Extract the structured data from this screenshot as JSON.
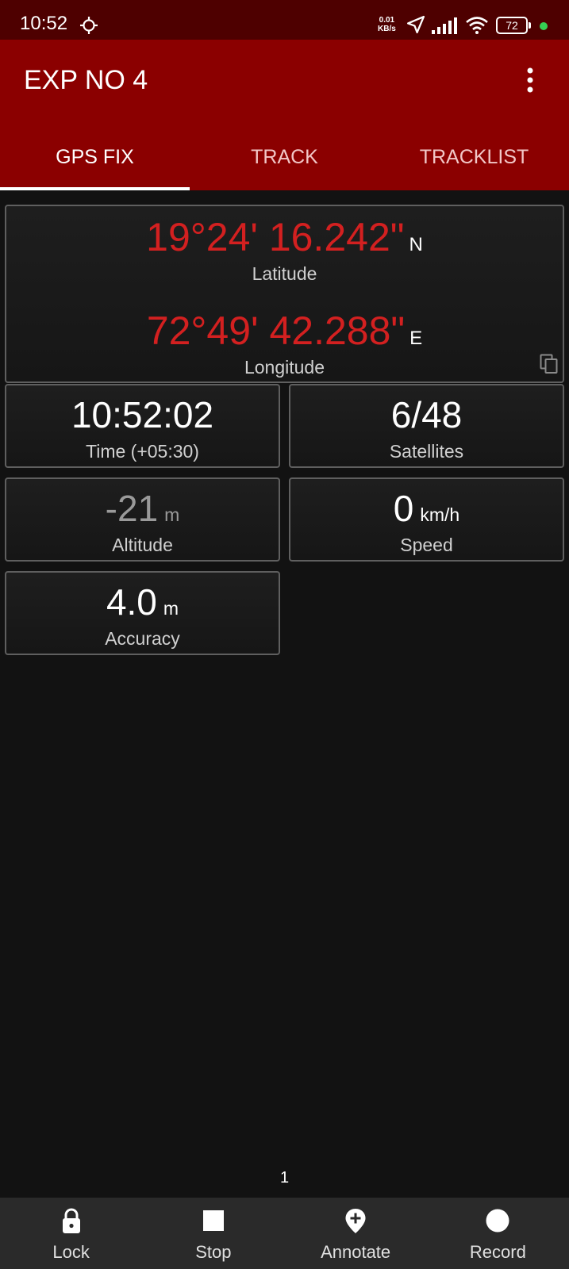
{
  "status_bar": {
    "time": "10:52",
    "net_speed_value": "0.01",
    "net_speed_unit": "KB/s",
    "battery": "72"
  },
  "app_bar": {
    "title": "EXP NO 4",
    "tabs": [
      {
        "label": "GPS FIX",
        "active": true
      },
      {
        "label": "TRACK",
        "active": false
      },
      {
        "label": "TRACKLIST",
        "active": false
      }
    ]
  },
  "coordinates": {
    "latitude_value": "19°24' 16.242\"",
    "latitude_hemisphere": "N",
    "latitude_label": "Latitude",
    "longitude_value": "72°49' 42.288\"",
    "longitude_hemisphere": "E",
    "longitude_label": "Longitude"
  },
  "stats": {
    "time": {
      "value": "10:52:02",
      "label": "Time (+05:30)"
    },
    "satellites": {
      "value": "6/48",
      "label": "Satellites"
    },
    "altitude": {
      "value": "-21",
      "unit": "m",
      "label": "Altitude"
    },
    "speed": {
      "value": "0",
      "unit": "km/h",
      "label": "Speed"
    },
    "accuracy": {
      "value": "4.0",
      "unit": "m",
      "label": "Accuracy"
    }
  },
  "page_number": "1",
  "bottom_bar": {
    "items": [
      {
        "label": "Lock",
        "icon": "lock-icon"
      },
      {
        "label": "Stop",
        "icon": "stop-icon"
      },
      {
        "label": "Annotate",
        "icon": "add-location-icon"
      },
      {
        "label": "Record",
        "icon": "record-icon"
      }
    ]
  },
  "colors": {
    "app_bar": "#8b0000",
    "status_bar": "#4e0000",
    "coordinate_text": "#d32020",
    "background": "#121212"
  }
}
